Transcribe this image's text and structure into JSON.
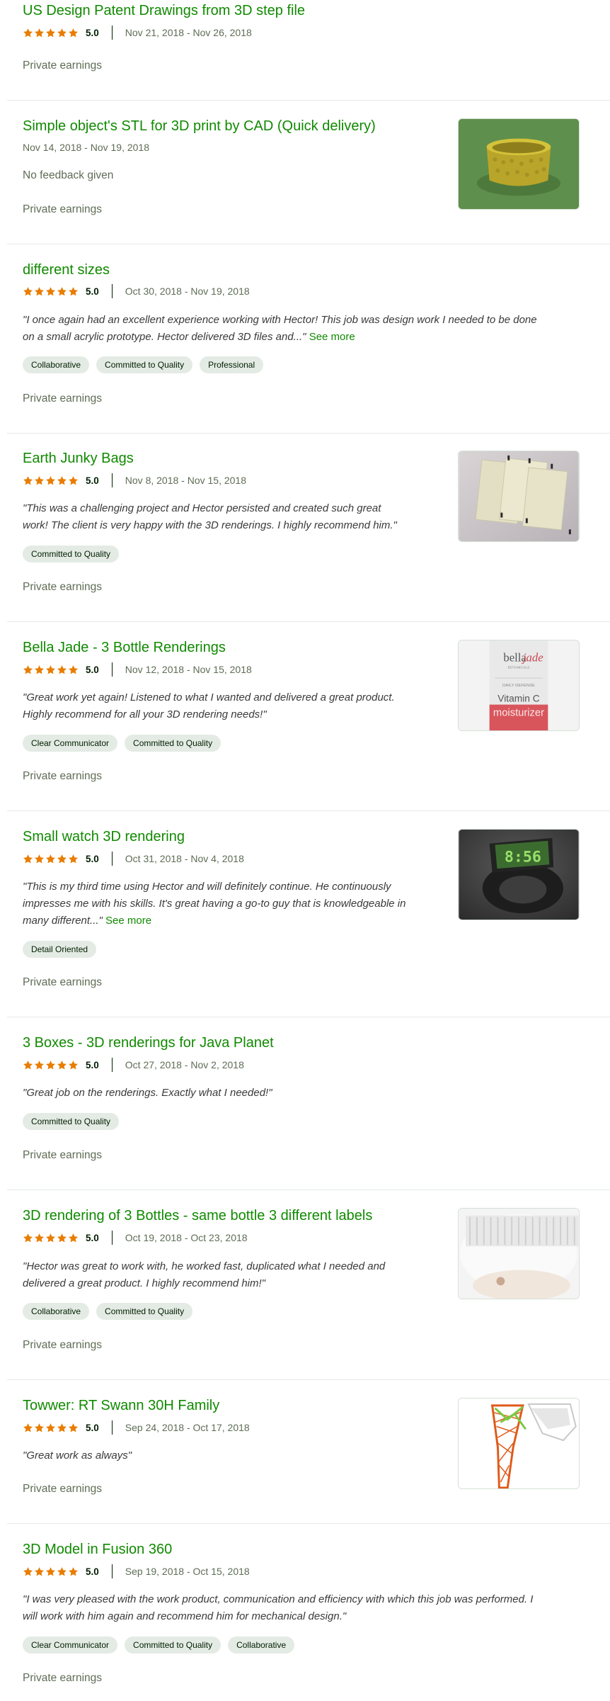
{
  "colors": {
    "title": "#108a00",
    "star": "#e87d00",
    "muted": "#5e6d55",
    "tag_bg": "#e4ebe4"
  },
  "items": [
    {
      "title": "US Design Patent Drawings from 3D step file",
      "rating": "5.0",
      "stars": 5,
      "dates": "Nov 21, 2018 - Nov 26, 2018",
      "earnings": "Private earnings"
    },
    {
      "title": "Simple object's STL for 3D print by CAD (Quick delivery)",
      "dates": "Nov 14, 2018 - Nov 19, 2018",
      "no_feedback": "No feedback given",
      "earnings": "Private earnings",
      "thumbnail": "green-3d-print-object"
    },
    {
      "title": "different sizes",
      "rating": "5.0",
      "stars": 5,
      "dates": "Oct 30, 2018 - Nov 19, 2018",
      "feedback_line1": "\"I once again had an excellent experience working with Hector! This job was design work I needed to be done",
      "feedback_line2": "on a small acrylic prototype. Hector delivered 3D files and...\"",
      "see_more": "See more",
      "tags": [
        "Collaborative",
        "Committed to Quality",
        "Professional"
      ],
      "earnings": "Private earnings"
    },
    {
      "title": "Earth Junky Bags",
      "rating": "5.0",
      "stars": 5,
      "dates": "Nov 8, 2018 - Nov 15, 2018",
      "feedback_line1": "\"This was a challenging project and Hector persisted and created such great",
      "feedback_line2": "work! The client is very happy with the 3D renderings. I highly recommend him.\"",
      "tags": [
        "Committed to Quality"
      ],
      "earnings": "Private earnings",
      "thumbnail": "bags-render"
    },
    {
      "title": "Bella Jade - 3 Bottle Renderings",
      "rating": "5.0",
      "stars": 5,
      "dates": "Nov 12, 2018 - Nov 15, 2018",
      "feedback_line1": "\"Great work yet again! Listened to what I wanted and delivered a great product.",
      "feedback_line2": "Highly recommend for all your 3D rendering needs!\"",
      "tags": [
        "Clear Communicator",
        "Committed to Quality"
      ],
      "earnings": "Private earnings",
      "thumbnail": "bottle-label-render",
      "thumb_text": {
        "brand_a": "bella",
        "brand_b": "jade",
        "brand_sub": "BOTANICALS",
        "daily": "DAILY DEFENSE",
        "vitamin": "Vitamin C",
        "moist": "moisturizer"
      }
    },
    {
      "title": "Small watch 3D rendering",
      "rating": "5.0",
      "stars": 5,
      "dates": "Oct 31, 2018 - Nov 4, 2018",
      "feedback_line1": "\"This is my third time using Hector and will definitely continue. He continuously",
      "feedback_line2": "impresses me with his skills. It's great having a go-to guy that is knowledgeable in",
      "feedback_line3": "many different...\"",
      "see_more": "See more",
      "tags": [
        "Detail Oriented"
      ],
      "earnings": "Private earnings",
      "thumbnail": "watch-render",
      "thumb_text": {
        "display": "8:56"
      }
    },
    {
      "title": "3 Boxes - 3D renderings for Java Planet",
      "rating": "5.0",
      "stars": 5,
      "dates": "Oct 27, 2018 - Nov 2, 2018",
      "feedback_line1": "\"Great job on the renderings. Exactly what I needed!\"",
      "tags": [
        "Committed to Quality"
      ],
      "earnings": "Private earnings"
    },
    {
      "title": "3D rendering of 3 Bottles - same bottle 3 different labels",
      "rating": "5.0",
      "stars": 5,
      "dates": "Oct 19, 2018 - Oct 23, 2018",
      "feedback_line1": "\"Hector was great to work with, he worked fast, duplicated what I needed and",
      "feedback_line2": "delivered a great product. I highly recommend him!\"",
      "tags": [
        "Collaborative",
        "Committed to Quality"
      ],
      "earnings": "Private earnings",
      "thumbnail": "bottle-cap-render"
    },
    {
      "title": "Towwer: RT Swann 30H Family",
      "rating": "5.0",
      "stars": 5,
      "dates": "Sep 24, 2018 - Oct 17, 2018",
      "feedback_line1": "\"Great work as always\"",
      "earnings": "Private earnings",
      "thumbnail": "tower-model"
    },
    {
      "title": "3D Model in Fusion 360",
      "rating": "5.0",
      "stars": 5,
      "dates": "Sep 19, 2018 - Oct 15, 2018",
      "feedback_line1": "\"I was very pleased with the work product, communication and efficiency with which this job was performed. I",
      "feedback_line2": "will work with him again and recommend him for mechanical design.\"",
      "tags": [
        "Clear Communicator",
        "Committed to Quality",
        "Collaborative"
      ],
      "earnings": "Private earnings"
    }
  ]
}
